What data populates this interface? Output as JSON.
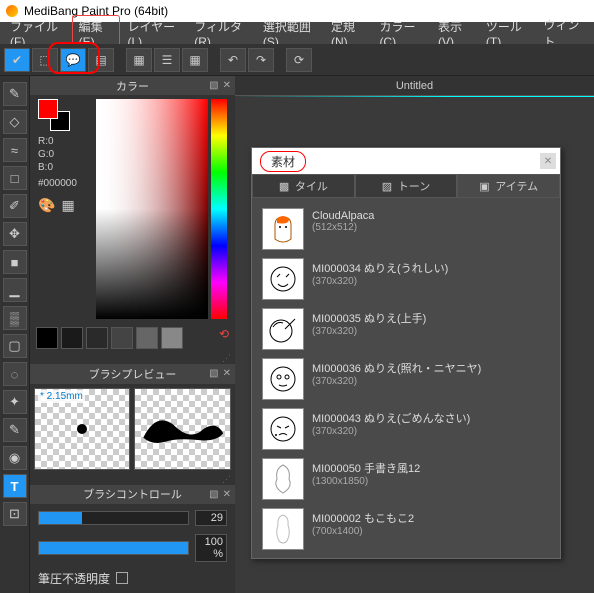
{
  "window": {
    "title": "MediBang Paint Pro (64bit)"
  },
  "menu": {
    "items": [
      "ファイル(F)",
      "編集(E)",
      "レイヤー(L)",
      "フィルタ(R)",
      "選択範囲(S)",
      "定規(N)",
      "カラー(C)",
      "表示(V)",
      "ツール(T)",
      "ウィント"
    ]
  },
  "panels": {
    "color": {
      "title": "カラー",
      "rgb": {
        "r": "R:0",
        "g": "G:0",
        "b": "B:0"
      },
      "hex": "#000000"
    },
    "brush_preview": {
      "title": "ブラシプレビュー",
      "size": "* 2.15mm"
    },
    "brush_control": {
      "title": "ブラシコントロール",
      "s1_val": "29",
      "s2_val": "100 %",
      "pressure_label": "筆圧不透明度"
    }
  },
  "document": {
    "tab": "Untitled"
  },
  "material": {
    "title": "素材",
    "tabs": {
      "tile": "タイル",
      "tone": "トーン",
      "item": "アイテム"
    },
    "items": [
      {
        "name": "CloudAlpaca",
        "dim": "(512x512)"
      },
      {
        "name": "MI000034 ぬりえ(うれしい)",
        "dim": "(370x320)"
      },
      {
        "name": "MI000035 ぬりえ(上手)",
        "dim": "(370x320)"
      },
      {
        "name": "MI000036 ぬりえ(照れ・ニヤニヤ)",
        "dim": "(370x320)"
      },
      {
        "name": "MI000043 ぬりえ(ごめんなさい)",
        "dim": "(370x320)"
      },
      {
        "name": "MI000050 手書き風12",
        "dim": "(1300x1850)"
      },
      {
        "name": "MI000002 もこもこ2",
        "dim": "(700x1400)"
      }
    ]
  }
}
